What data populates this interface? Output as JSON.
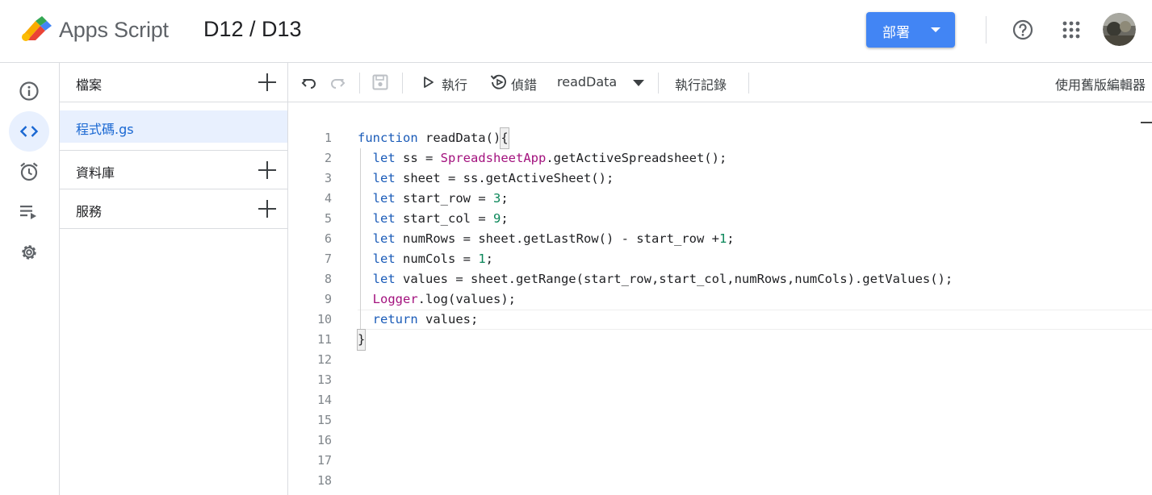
{
  "header": {
    "app_name": "Apps Script",
    "project_title": "D12 / D13",
    "deploy_label": "部署"
  },
  "rail": {
    "items": [
      "overview-icon",
      "code-editor-icon",
      "triggers-icon",
      "executions-icon",
      "settings-icon"
    ]
  },
  "files": {
    "files_label": "檔案",
    "file_name": "程式碼.gs",
    "libraries_label": "資料庫",
    "services_label": "服務"
  },
  "toolbar": {
    "run_label": "執行",
    "debug_label": "偵錯",
    "function_name": "readData",
    "exec_log_label": "執行記錄",
    "legacy_editor_label": "使用舊版編輯器"
  },
  "editor": {
    "line_numbers": [
      "1",
      "2",
      "3",
      "4",
      "5",
      "6",
      "7",
      "8",
      "9",
      "10",
      "11",
      "12",
      "13",
      "14",
      "15",
      "16",
      "17",
      "18"
    ],
    "code_lines": [
      "function readData(){",
      "  let ss = SpreadsheetApp.getActiveSpreadsheet();",
      "  let sheet = ss.getActiveSheet();",
      "  let start_row = 3;",
      "  let start_col = 9;",
      "  let numRows = sheet.getLastRow() - start_row +1;",
      "  let numCols = 1;",
      "  let values = sheet.getRange(start_row,start_col,numRows,numCols).getValues();",
      "  Logger.log(values);",
      "  return values;",
      "}"
    ]
  },
  "colors": {
    "accent": "#4285f4",
    "selected_bg": "#e8f0fe",
    "selected_text": "#1967d2",
    "keyword": "#1a5bb8",
    "class_name": "#a3127e",
    "number": "#098658"
  }
}
